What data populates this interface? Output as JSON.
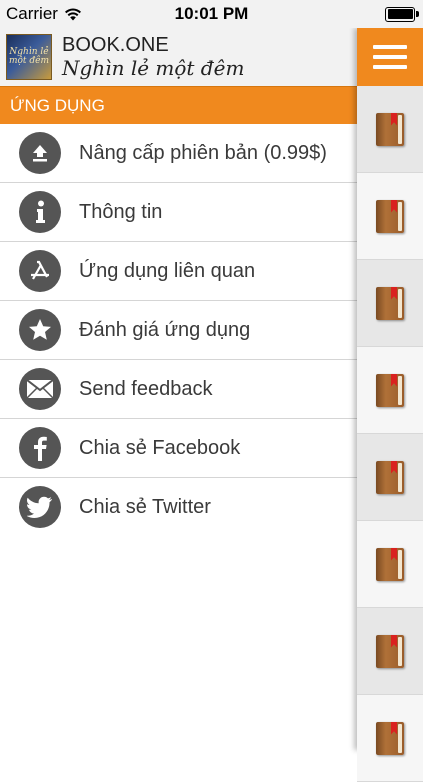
{
  "status_bar": {
    "carrier": "Carrier",
    "time": "10:01 PM",
    "battery_level": 1.0
  },
  "header": {
    "app_name": "BOOK.ONE",
    "book_title": "Nghìn lẻ một đêm",
    "thumb_text": "Nghìn lẻ một đêm"
  },
  "section": {
    "title": "ỨNG DỤNG"
  },
  "menu": {
    "items": [
      {
        "label": "Nâng cấp phiên bản (0.99$)",
        "icon": "upload-icon"
      },
      {
        "label": "Thông tin",
        "icon": "info-icon"
      },
      {
        "label": "Ứng dụng liên quan",
        "icon": "app-store-icon"
      },
      {
        "label": "Đánh giá ứng dụng",
        "icon": "star-icon"
      },
      {
        "label": "Send feedback",
        "icon": "mail-icon"
      },
      {
        "label": "Chia sẻ Facebook",
        "icon": "facebook-icon"
      },
      {
        "label": "Chia sẻ Twitter",
        "icon": "twitter-icon"
      }
    ]
  },
  "rail": {
    "book_count": 8,
    "book_icon": "book-bookmark-icon",
    "menu_icon": "hamburger-menu-icon"
  },
  "colors": {
    "accent": "#f0891e",
    "icon_bg": "#555555",
    "text": "#3a3a3a"
  }
}
